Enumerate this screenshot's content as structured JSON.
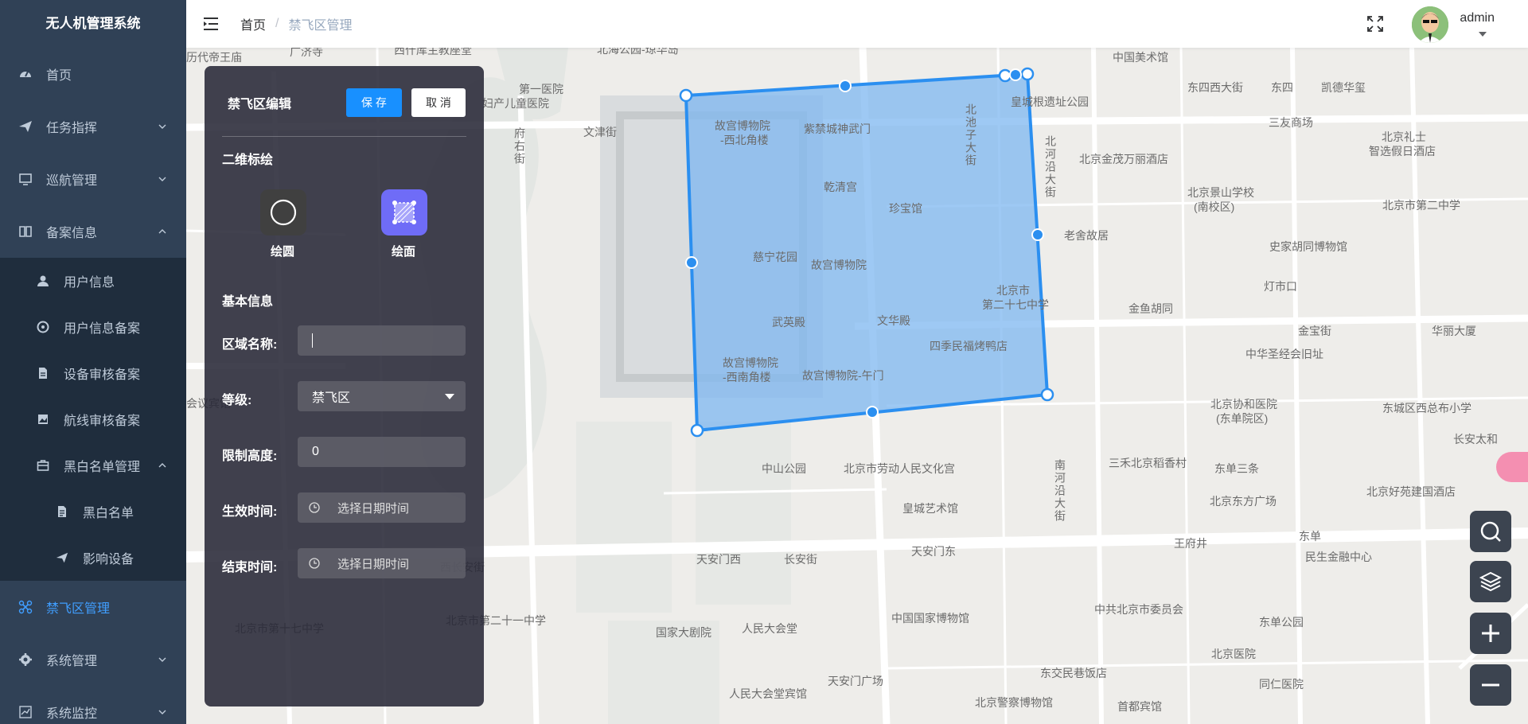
{
  "app": {
    "title": "无人机管理系统"
  },
  "sidebar": {
    "items": [
      {
        "label": "首页",
        "icon": "dashboard-icon"
      },
      {
        "label": "任务指挥",
        "icon": "send-icon"
      },
      {
        "label": "巡航管理",
        "icon": "monitor-icon"
      },
      {
        "label": "备案信息",
        "icon": "book-icon"
      }
    ],
    "record_sub": [
      {
        "label": "用户信息",
        "icon": "user-icon"
      },
      {
        "label": "用户信息备案",
        "icon": "aperture-icon"
      },
      {
        "label": "设备审核备案",
        "icon": "doc-icon"
      },
      {
        "label": "航线审核备案",
        "icon": "image-icon"
      },
      {
        "label": "黑白名单管理",
        "icon": "briefcase-icon"
      }
    ],
    "blacklist_sub": [
      {
        "label": "黑白名单",
        "icon": "file-icon"
      },
      {
        "label": "影响设备",
        "icon": "send-icon"
      }
    ],
    "bottom": [
      {
        "label": "禁飞区管理",
        "icon": "drone-icon"
      },
      {
        "label": "系统管理",
        "icon": "gear-icon"
      },
      {
        "label": "系统监控",
        "icon": "chart-icon"
      }
    ]
  },
  "header": {
    "breadcrumb_home": "首页",
    "breadcrumb_sep": "/",
    "breadcrumb_current": "禁飞区管理",
    "username": "admin"
  },
  "panel": {
    "title": "禁飞区编辑",
    "save": "保 存",
    "cancel": "取 消",
    "section_draw": "二维标绘",
    "tool_circle": "绘圆",
    "tool_polygon": "绘面",
    "section_basic": "基本信息",
    "area_name_label": "区域名称:",
    "area_name_value": "",
    "level_label": "等级:",
    "level_value": "禁飞区",
    "height_label": "限制高度:",
    "height_value": "0",
    "start_label": "生效时间:",
    "start_placeholder": "选择日期时间",
    "end_label": "结束时间:",
    "end_placeholder": "选择日期时间"
  },
  "map": {
    "labels": [
      "历代帝王庙",
      "广济寺",
      "西什库主教座堂",
      "北海公园-琼华岛",
      "中国美术馆",
      "东四西大街",
      "东四",
      "凯德华玺",
      "第一医院",
      "妇产儿童医院",
      "文津街",
      "皇城根遗址公园",
      "三友商场",
      "北京礼士",
      "智选假日酒店",
      "故宫博物院",
      "-西北角楼",
      "紫禁城神武门",
      "北池子大街",
      "北京金茂万丽酒店",
      "北京景山学校",
      "(南校区)",
      "北京市第二中学",
      "府右街",
      "乾清宫",
      "珍宝馆",
      "北河沿大街",
      "老舍故居",
      "史家胡同博物馆",
      "慈宁花园",
      "故宫博物院",
      "灯市口",
      "北京市",
      "第二十七中学",
      "金鱼胡同",
      "武英殿",
      "文华殿",
      "四季民福烤鸭店",
      "金宝街",
      "华丽大厦",
      "中华圣经会旧址",
      "故宫博物院",
      "-西南角楼",
      "故宫博物院-午门",
      "北京协和医院",
      "(东单院区)",
      "东城区西总布小学",
      "会议宾馆",
      "长安太和",
      "中山公园",
      "北京市劳动人民文化宫",
      "三禾北京稻香村",
      "东单三条",
      "南河沿大街",
      "皇城艺术馆",
      "北京东方广场",
      "北京好苑建国酒店",
      "东单",
      "民生金融中心",
      "天安门西",
      "长安街",
      "天安门东",
      "王府井",
      "西长安街",
      "国家大剧院",
      "人民大会堂",
      "中国国家博物馆",
      "中共北京市委员会",
      "东单公园",
      "北京医院",
      "同仁医院",
      "天安门广场",
      "东交民巷饭店",
      "人民大会堂宾馆",
      "北京警察博物馆",
      "首都宾馆",
      "北京市第十七中学",
      "北京市第二十一中学"
    ]
  },
  "colors": {
    "sidebar_bg": "#304156",
    "sidebar_active": "#409eff",
    "polygon_fill": "#7db7f0",
    "polygon_stroke": "#2b8ff0",
    "primary": "#1890ff",
    "tool_polygon_bg": "#6f6cf7"
  }
}
